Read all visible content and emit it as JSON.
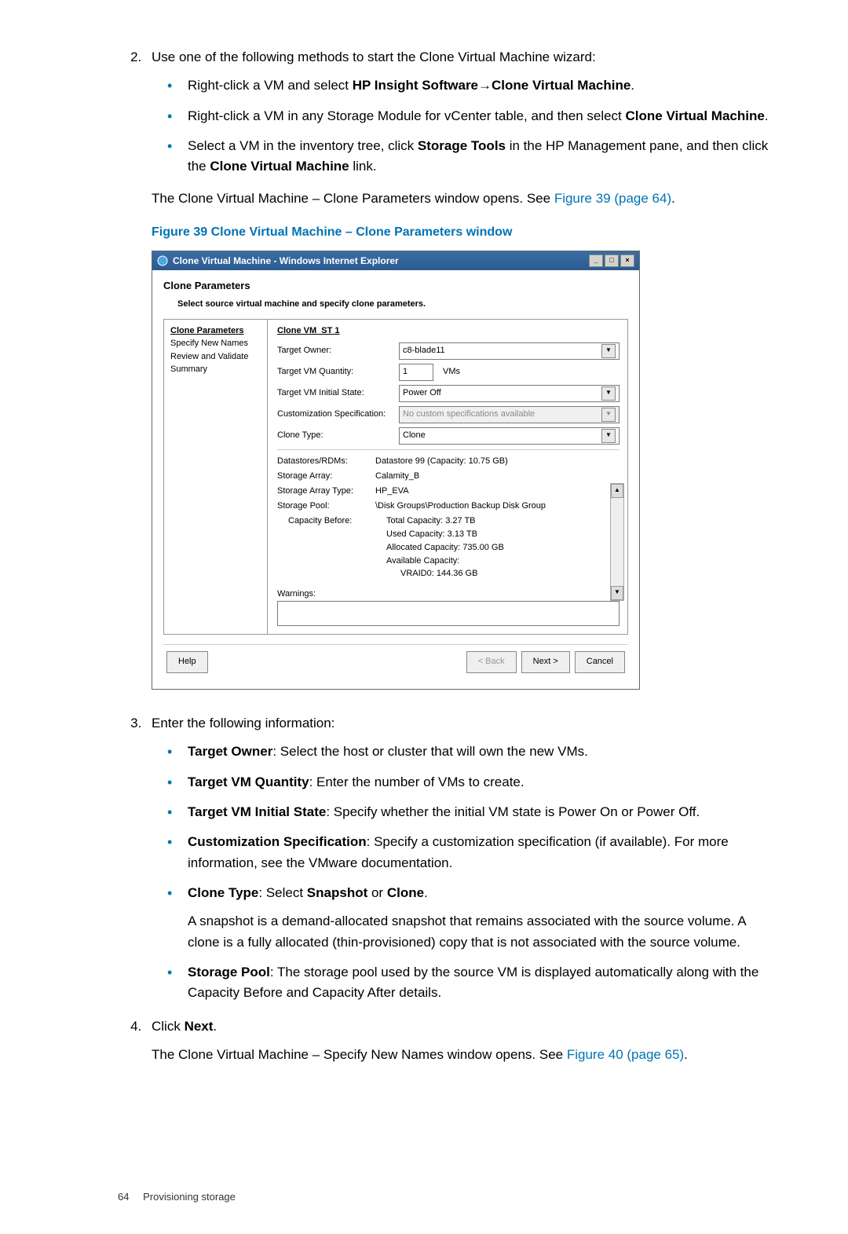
{
  "step2": {
    "intro": "Use one of the following methods to start the Clone Virtual Machine wizard:",
    "b1a": "Right-click a VM and select ",
    "b1b": "HP Insight Software",
    "b1arrow": "→",
    "b1c": "Clone Virtual Machine",
    "b1d": ".",
    "b2a": "Right-click a VM in any Storage Module for vCenter table, and then select ",
    "b2b": "Clone Virtual Machine",
    "b2c": ".",
    "b3a": "Select a VM in the inventory tree, click ",
    "b3b": "Storage Tools",
    "b3c": " in the HP Management pane, and then click the ",
    "b3d": "Clone Virtual Machine",
    "b3e": " link.",
    "closing_a": "The Clone Virtual Machine – Clone Parameters window opens. See ",
    "closing_link": "Figure 39 (page 64)",
    "closing_b": "."
  },
  "fig39_title": "Figure 39 Clone Virtual Machine – Clone Parameters window",
  "win": {
    "title": "Clone Virtual Machine - Windows Internet Explorer",
    "min": "_",
    "max": "□",
    "close": "×",
    "heading": "Clone Parameters",
    "sub": "Select source virtual machine and specify clone parameters.",
    "side": {
      "s1": "Clone Parameters",
      "s2": "Specify New Names",
      "s3": "Review and Validate",
      "s4": "Summary"
    },
    "group": "Clone VM_ST 1",
    "labels": {
      "owner": "Target Owner:",
      "qty": "Target VM Quantity:",
      "vms": "VMs",
      "state": "Target VM Initial State:",
      "spec": "Customization Specification:",
      "type": "Clone Type:",
      "ds": "Datastores/RDMs:",
      "arr": "Storage Array:",
      "arrtype": "Storage Array Type:",
      "pool": "Storage Pool:",
      "capb": "Capacity Before:",
      "warn": "Warnings:"
    },
    "vals": {
      "owner": "c8-blade11",
      "qty": "1",
      "state": "Power Off",
      "spec": "No custom specifications available",
      "type": "Clone",
      "ds": "Datastore 99 (Capacity: 10.75 GB)",
      "arr": "Calamity_B",
      "arrtype": "HP_EVA",
      "pool": "\\Disk Groups\\Production Backup Disk Group",
      "cap1": "Total Capacity: 3.27 TB",
      "cap2": "Used Capacity: 3.13 TB",
      "cap3": "Allocated Capacity: 735.00 GB",
      "cap4": "Available Capacity:",
      "cap5": "VRAID0: 144.36 GB"
    },
    "btns": {
      "help": "Help",
      "back": "< Back",
      "next": "Next >",
      "cancel": "Cancel"
    },
    "arrow_down": "▼",
    "arrow_up": "▲"
  },
  "step3": {
    "intro": "Enter the following information:",
    "b1a": "Target Owner",
    "b1b": ": Select the host or cluster that will own the new VMs.",
    "b2a": "Target VM Quantity",
    "b2b": ": Enter the number of VMs to create.",
    "b3a": "Target VM Initial State",
    "b3b": ": Specify whether the initial VM state is Power On or Power Off.",
    "b4a": "Customization Specification",
    "b4b": ": Specify a customization specification (if available). For more information, see the VMware documentation.",
    "b5a": "Clone Type",
    "b5b": ": Select ",
    "b5c": "Snapshot",
    "b5d": " or ",
    "b5e": "Clone",
    "b5f": ".",
    "b5para": "A snapshot is a demand-allocated snapshot that remains associated with the source volume. A clone is a fully allocated (thin-provisioned) copy that is not associated with the source volume.",
    "b6a": "Storage Pool",
    "b6b": ": The storage pool used by the source VM is displayed automatically along with the Capacity Before and Capacity After details."
  },
  "step4": {
    "a": "Click ",
    "b": "Next",
    "c": ".",
    "closing_a": "The Clone Virtual Machine – Specify New Names window opens. See ",
    "closing_link": "Figure 40 (page 65)",
    "closing_b": "."
  },
  "footer": {
    "page": "64",
    "section": "Provisioning storage"
  }
}
